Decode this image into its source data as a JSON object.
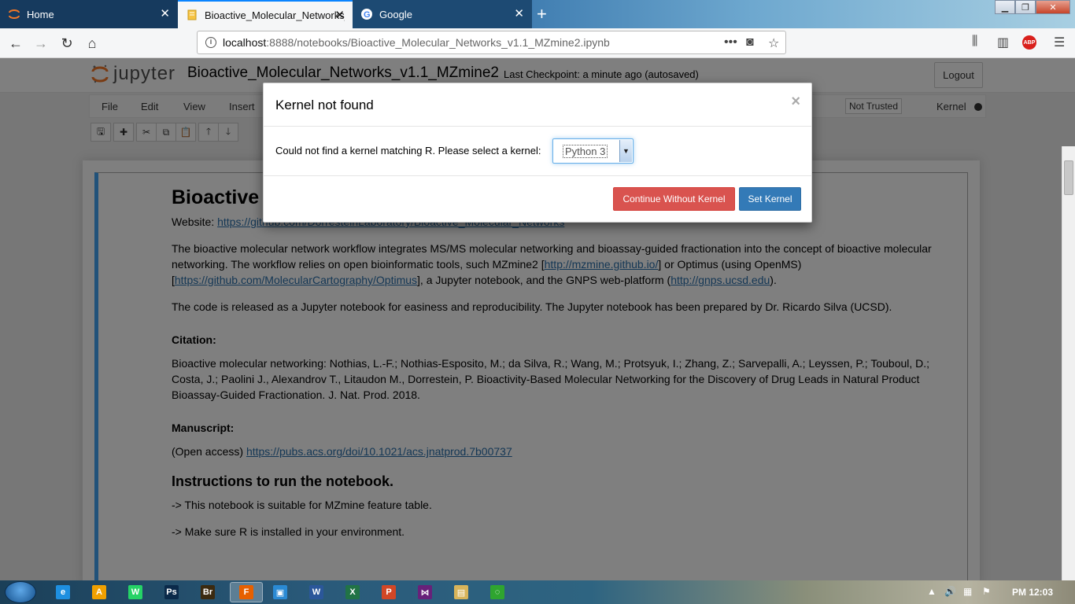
{
  "browser": {
    "tabs": [
      {
        "label": "Home",
        "icon": "jupyter-icon"
      },
      {
        "label": "Bioactive_Molecular_Networks_",
        "icon": "notebook-icon",
        "active": true
      },
      {
        "label": "Google",
        "icon": "google-icon"
      }
    ],
    "url_host": "localhost",
    "url_rest": ":8888/notebooks/Bioactive_Molecular_Networks_v1.1_MZmine2.ipynb",
    "abp_label": "ABP"
  },
  "jupyter": {
    "logo_text": "jupyter",
    "notebook_name": "Bioactive_Molecular_Networks_v1.1_MZmine2",
    "checkpoint": "Last Checkpoint: a minute ago  (autosaved)",
    "logout_label": "Logout",
    "menu": [
      "File",
      "Edit",
      "View",
      "Insert"
    ],
    "trust_label": "Not Trusted",
    "kernel_label": "Kernel"
  },
  "cell": {
    "title": "Bioactive",
    "website_label": "Website: ",
    "website_link": "https://github.com/DorresteinLaboratory/Bioactive_Molecular_Networks",
    "intro_1": "The bioactive molecular network workflow integrates MS/MS molecular networking and bioassay-guided fractionation into the concept of bioactive molecular networking. The workflow relies on open bioinformatic tools, such MZmine2 [",
    "mzmine_link": "http://mzmine.github.io/",
    "intro_2": "] or Optimus (using OpenMS) [",
    "optimus_link": "https://github.com/MolecularCartography/Optimus",
    "intro_3": "], a Jupyter notebook, and the GNPS web-platform (",
    "gnps_link": "http://gnps.ucsd.edu",
    "intro_4": ").",
    "code_release": "The code is released as a Jupyter notebook for easiness and reproducibility. The Jupyter notebook has been prepared by Dr. Ricardo Silva (UCSD).",
    "citation_heading": "Citation:",
    "citation_text": "Bioactive molecular networking: Nothias, L.-F.; Nothias-Esposito, M.; da Silva, R.; Wang, M.; Protsyuk, I.; Zhang, Z.; Sarvepalli, A.; Leyssen, P.; Touboul, D.; Costa, J.; Paolini J., Alexandrov T., Litaudon M., Dorrestein, P. Bioactivity-Based Molecular Networking for the Discovery of Drug Leads in Natural Product Bioassay-Guided Fractionation. J. Nat. Prod. 2018.",
    "manuscript_heading": "Manuscript:",
    "manuscript_prefix": "(Open access) ",
    "manuscript_link": "https://pubs.acs.org/doi/10.1021/acs.jnatprod.7b00737",
    "instructions_heading": "Instructions to run the notebook.",
    "instruction_1": "-> This notebook is suitable for MZmine feature table.",
    "instruction_2": "-> Make sure R is installed in your environment."
  },
  "modal": {
    "title": "Kernel not found",
    "close": "×",
    "message": "Could not find a kernel matching R. Please select a kernel:",
    "selected_kernel": "Python 3",
    "continue_label": "Continue Without Kernel",
    "set_label": "Set Kernel"
  },
  "taskbar": {
    "apps": [
      {
        "name": "ie-icon",
        "glyph": "e",
        "color": "#1e8fe0"
      },
      {
        "name": "avast-icon",
        "glyph": "A",
        "color": "#f0a000"
      },
      {
        "name": "whatsapp-icon",
        "glyph": "W",
        "color": "#25d366"
      },
      {
        "name": "photoshop-icon",
        "glyph": "Ps",
        "color": "#0b2a4a"
      },
      {
        "name": "bridge-icon",
        "glyph": "Br",
        "color": "#3b2a10"
      },
      {
        "name": "firefox-icon",
        "glyph": "F",
        "color": "#e66000",
        "active": true
      },
      {
        "name": "screen-icon",
        "glyph": "▣",
        "color": "#2a8ad4"
      },
      {
        "name": "word-icon",
        "glyph": "W",
        "color": "#2b579a"
      },
      {
        "name": "excel-icon",
        "glyph": "X",
        "color": "#217346"
      },
      {
        "name": "powerpoint-icon",
        "glyph": "P",
        "color": "#d24726"
      },
      {
        "name": "vs-icon",
        "glyph": "⋈",
        "color": "#68217a"
      },
      {
        "name": "explorer-icon",
        "glyph": "▤",
        "color": "#d8b45a"
      },
      {
        "name": "loader-icon",
        "glyph": "◌",
        "color": "#2fa52f"
      }
    ],
    "clock": "PM 12:03"
  },
  "colors": {
    "danger": "#d9534f",
    "primary": "#337ab7",
    "cell_selected": "#42a5f5"
  }
}
